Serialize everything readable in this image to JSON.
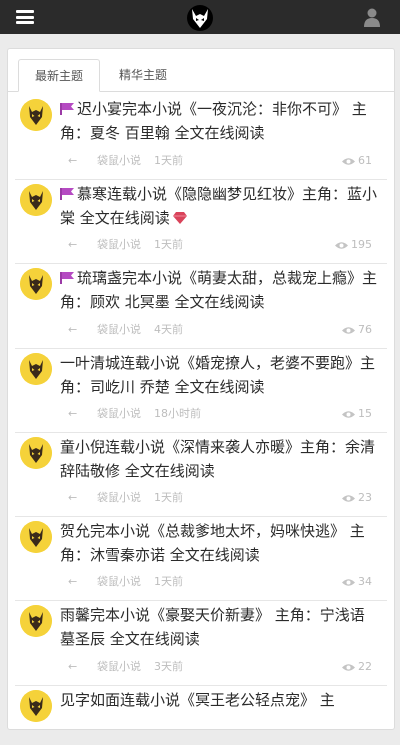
{
  "header": {
    "menu_icon": "hamburger-icon",
    "logo_icon": "wolf-logo-icon",
    "user_icon": "user-icon"
  },
  "tabs": [
    {
      "label": "最新主题",
      "active": true
    },
    {
      "label": "精华主题",
      "active": false
    }
  ],
  "topics": [
    {
      "pinned": true,
      "title": "迟小宴完本小说《一夜沉沦：非你不可》 主角：夏冬 百里翰 全文在线阅读",
      "gem": false,
      "author": "袋鼠小说",
      "time": "1天前",
      "views": "61"
    },
    {
      "pinned": true,
      "title": "慕寒连载小说《隐隐幽梦见红妆》主角：蓝小棠 全文在线阅读",
      "gem": true,
      "author": "袋鼠小说",
      "time": "1天前",
      "views": "195"
    },
    {
      "pinned": true,
      "title": "琉璃盏完本小说《萌妻太甜，总裁宠上瘾》主角：顾欢 北冥墨 全文在线阅读",
      "gem": false,
      "author": "袋鼠小说",
      "time": "4天前",
      "views": "76"
    },
    {
      "pinned": false,
      "title": "一叶清城连载小说《婚宠撩人，老婆不要跑》主角：司屹川 乔楚 全文在线阅读",
      "gem": false,
      "author": "袋鼠小说",
      "time": "18小时前",
      "views": "15"
    },
    {
      "pinned": false,
      "title": "童小倪连载小说《深情来袭人亦暖》主角：余清辞陆敬修 全文在线阅读",
      "gem": false,
      "author": "袋鼠小说",
      "time": "1天前",
      "views": "23"
    },
    {
      "pinned": false,
      "title": "贺允完本小说《总裁爹地太坏，妈咪快逃》 主角：沐雪秦亦诺 全文在线阅读",
      "gem": false,
      "author": "袋鼠小说",
      "time": "1天前",
      "views": "34"
    },
    {
      "pinned": false,
      "title": "雨馨完本小说《豪娶天价新妻》 主角：宁浅语 墓圣辰 全文在线阅读",
      "gem": false,
      "author": "袋鼠小说",
      "time": "3天前",
      "views": "22"
    },
    {
      "pinned": false,
      "title": "见字如面连载小说《冥王老公轻点宠》 主",
      "gem": false,
      "author": "",
      "time": "",
      "views": ""
    }
  ]
}
